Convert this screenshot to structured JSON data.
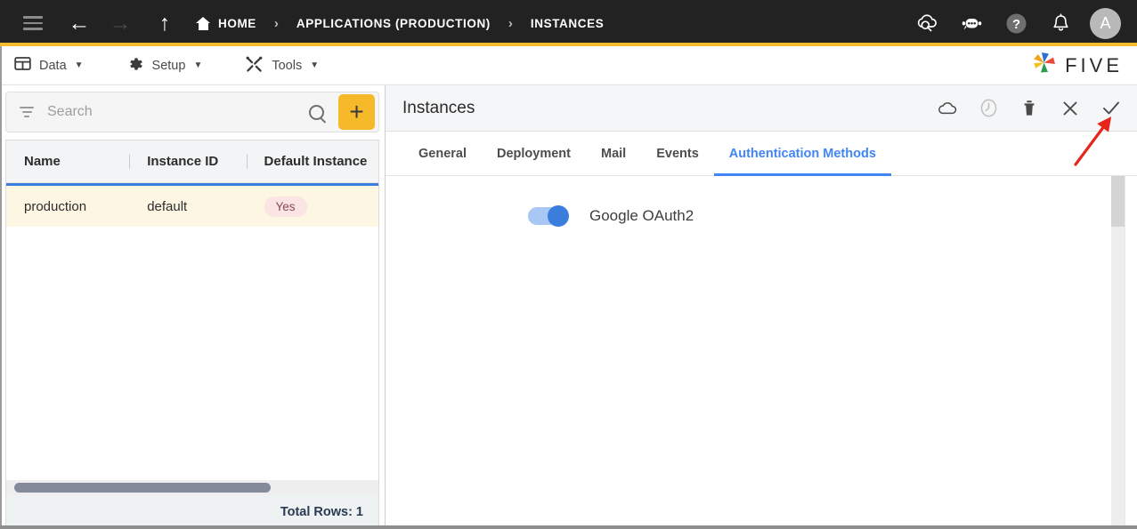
{
  "topbar": {
    "icons": {
      "menu": "hamburger-icon",
      "back": "arrow-back-icon",
      "forward": "arrow-forward-icon",
      "up": "arrow-up-icon"
    },
    "breadcrumbs": [
      {
        "label": "HOME",
        "icon": "home-icon"
      },
      {
        "label": "APPLICATIONS (PRODUCTION)",
        "icon": ""
      },
      {
        "label": "INSTANCES",
        "icon": ""
      }
    ],
    "separator": "›",
    "right_icons": [
      {
        "name": "cloud-search-icon"
      },
      {
        "name": "robot-assistant-icon"
      },
      {
        "name": "help-icon"
      },
      {
        "name": "notifications-bell-icon"
      }
    ],
    "avatar_initial": "A",
    "accent_color": "#f5bd2e",
    "background_color": "#222222"
  },
  "menubar": {
    "items": [
      {
        "label": "Data",
        "icon": "table-icon",
        "caret": "▼"
      },
      {
        "label": "Setup",
        "icon": "gear-icon",
        "caret": "▼"
      },
      {
        "label": "Tools",
        "icon": "tools-icon",
        "caret": "▼"
      }
    ],
    "brand": "FIVE"
  },
  "left_panel": {
    "search": {
      "placeholder": "Search",
      "value": "",
      "filter_icon": "filter-icon",
      "search_icon": "search-icon"
    },
    "add_button": {
      "label": "+",
      "color": "#f5b929"
    },
    "table": {
      "columns": [
        "Name",
        "Instance ID",
        "Default Instance"
      ],
      "rows": [
        {
          "name": "production",
          "instance_id": "default",
          "default_instance": "Yes"
        }
      ]
    },
    "footer": {
      "total_rows_label": "Total Rows: 1"
    }
  },
  "right_panel": {
    "title": "Instances",
    "actions": [
      {
        "name": "cloud-deploy-icon",
        "enabled": true
      },
      {
        "name": "history-clock-icon",
        "enabled": false
      },
      {
        "name": "delete-trash-icon",
        "enabled": true
      },
      {
        "name": "close-icon",
        "enabled": true
      },
      {
        "name": "save-check-icon",
        "enabled": true
      }
    ],
    "tabs": [
      {
        "label": "General",
        "active": false
      },
      {
        "label": "Deployment",
        "active": false
      },
      {
        "label": "Mail",
        "active": false
      },
      {
        "label": "Events",
        "active": false
      },
      {
        "label": "Authentication Methods",
        "active": true
      }
    ],
    "active_tab_color": "#4285f4",
    "content": {
      "toggles": [
        {
          "label": "Google OAuth2",
          "on": true
        }
      ]
    }
  },
  "annotation": {
    "type": "red-arrow",
    "color": "#e8251b",
    "points_to": "save-check-icon"
  }
}
